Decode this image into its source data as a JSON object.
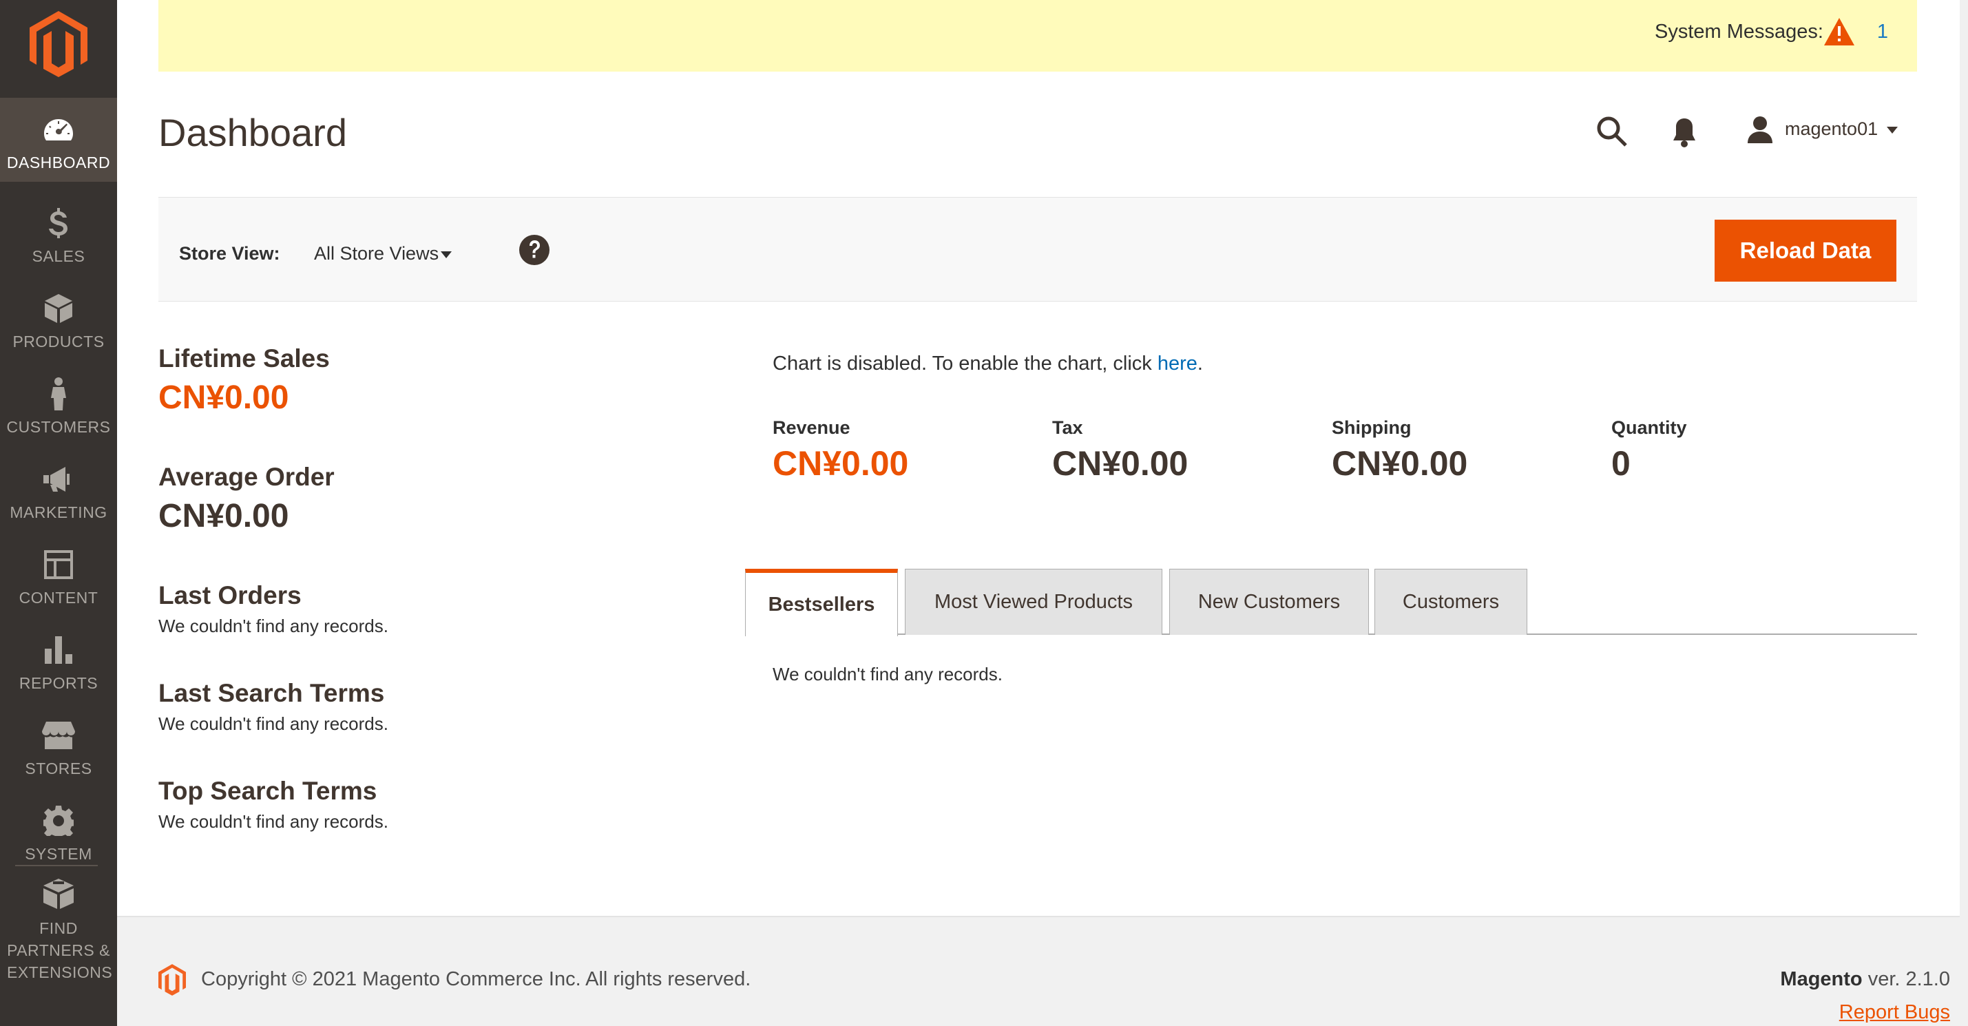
{
  "brand": {
    "accent": "#eb5202",
    "sidebar_bg": "#373330",
    "notice_bg": "#fffbbb",
    "link": "#006bb4"
  },
  "sidebar": {
    "logo_icon": "magento-logo-icon",
    "items": [
      {
        "label": "DASHBOARD",
        "icon": "dashboard-gauge-icon",
        "active": true
      },
      {
        "label": "SALES",
        "icon": "dollar-icon"
      },
      {
        "label": "PRODUCTS",
        "icon": "box-icon"
      },
      {
        "label": "CUSTOMERS",
        "icon": "person-icon"
      },
      {
        "label": "MARKETING",
        "icon": "megaphone-icon"
      },
      {
        "label": "CONTENT",
        "icon": "layout-icon"
      },
      {
        "label": "REPORTS",
        "icon": "bar-chart-icon"
      },
      {
        "label": "STORES",
        "icon": "storefront-icon"
      },
      {
        "label": "SYSTEM",
        "icon": "gear-icon"
      },
      {
        "label": "FIND PARTNERS & EXTENSIONS",
        "icon": "extensions-box-icon"
      }
    ]
  },
  "system_messages": {
    "label": "System Messages:",
    "count": "1",
    "icon": "warning-icon"
  },
  "header": {
    "title": "Dashboard",
    "username": "magento01",
    "icons": [
      "search-icon",
      "bell-icon",
      "user-icon"
    ]
  },
  "store_switcher": {
    "label": "Store View:",
    "value": "All Store Views",
    "help_icon": "help-icon",
    "reload_label": "Reload Data"
  },
  "stats": {
    "lifetime_sales": {
      "title": "Lifetime Sales",
      "value": "CN¥0.00"
    },
    "average_order": {
      "title": "Average Order",
      "value": "CN¥0.00"
    },
    "last_orders": {
      "title": "Last Orders",
      "empty": "We couldn't find any records."
    },
    "last_search_terms": {
      "title": "Last Search Terms",
      "empty": "We couldn't find any records."
    },
    "top_search_terms": {
      "title": "Top Search Terms",
      "empty": "We couldn't find any records."
    }
  },
  "chart": {
    "message": "Chart is disabled. To enable the chart, click ",
    "link_text": "here",
    "message_end": "."
  },
  "totals": [
    {
      "label": "Revenue",
      "value": "CN¥0.00"
    },
    {
      "label": "Tax",
      "value": "CN¥0.00"
    },
    {
      "label": "Shipping",
      "value": "CN¥0.00"
    },
    {
      "label": "Quantity",
      "value": "0"
    }
  ],
  "tabs": {
    "items": [
      {
        "label": "Bestsellers",
        "active": true
      },
      {
        "label": "Most Viewed Products"
      },
      {
        "label": "New Customers"
      },
      {
        "label": "Customers"
      }
    ],
    "empty": "We couldn't find any records."
  },
  "footer": {
    "copyright": "Copyright © 2021 Magento Commerce Inc. All rights reserved.",
    "brand": "Magento",
    "version": " ver. 2.1.0",
    "report_bugs": "Report Bugs"
  }
}
